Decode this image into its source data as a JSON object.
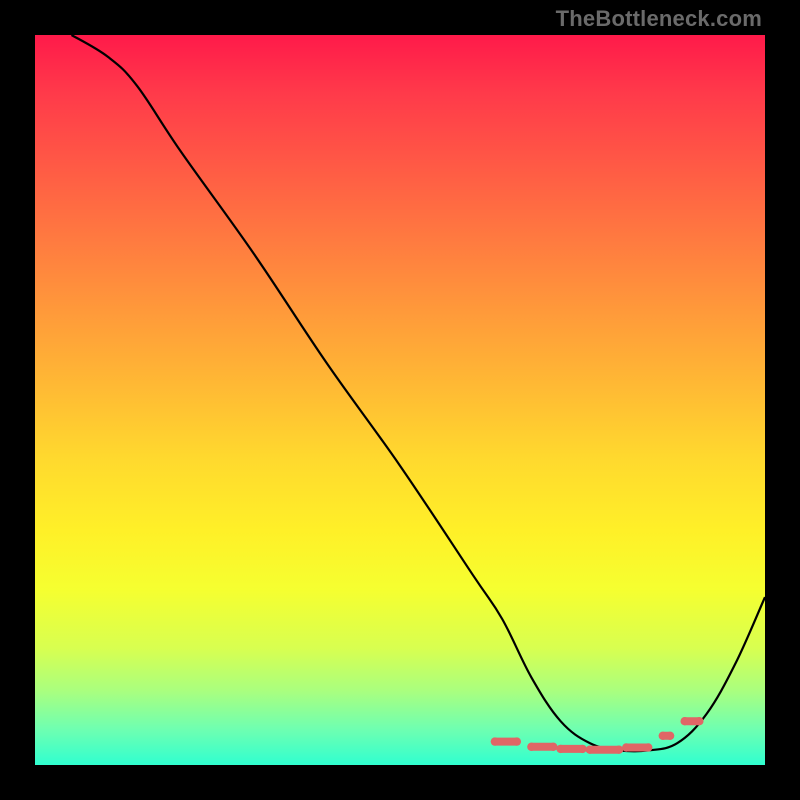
{
  "watermark": "TheBottleneck.com",
  "chart_data": {
    "type": "line",
    "title": "",
    "xlabel": "",
    "ylabel": "",
    "xlim": [
      0,
      100
    ],
    "ylim": [
      0,
      100
    ],
    "series": [
      {
        "name": "curve",
        "x": [
          5,
          10,
          14,
          20,
          30,
          40,
          50,
          60,
          64,
          68,
          72,
          76,
          80,
          84,
          88,
          92,
          96,
          100
        ],
        "values": [
          100,
          97,
          93,
          84,
          70,
          55,
          41,
          26,
          20,
          12,
          6,
          3,
          2,
          2,
          3,
          7,
          14,
          23
        ]
      }
    ],
    "highlight_dashes": [
      {
        "x0": 63,
        "x1": 66,
        "y": 3.2
      },
      {
        "x0": 68,
        "x1": 71,
        "y": 2.5
      },
      {
        "x0": 72,
        "x1": 75,
        "y": 2.2
      },
      {
        "x0": 76,
        "x1": 80,
        "y": 2.1
      },
      {
        "x0": 81,
        "x1": 84,
        "y": 2.4
      },
      {
        "x0": 86,
        "x1": 87,
        "y": 4.0
      },
      {
        "x0": 89,
        "x1": 91,
        "y": 6.0
      }
    ]
  }
}
